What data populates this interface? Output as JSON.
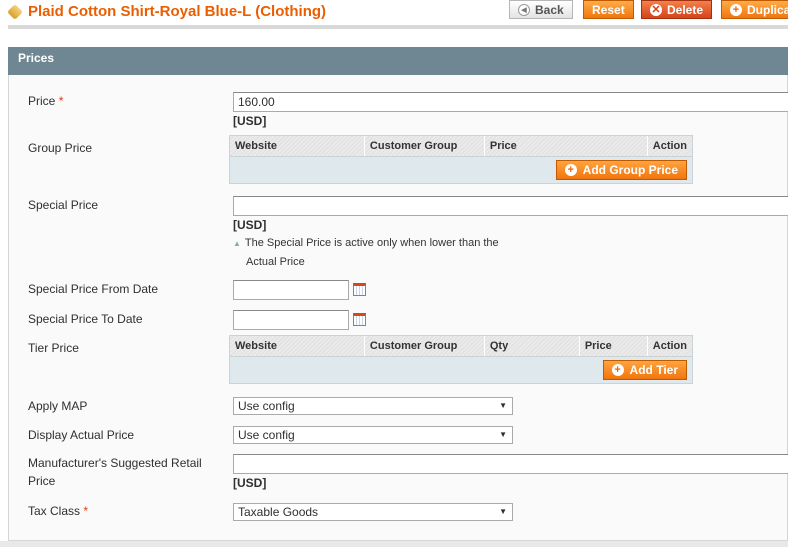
{
  "header": {
    "title": "Plaid Cotton Shirt-Royal Blue-L (Clothing)",
    "buttons": {
      "back": "Back",
      "reset": "Reset",
      "delete": "Delete",
      "duplicate": "Duplicate"
    }
  },
  "section": {
    "title": "Prices"
  },
  "fields": {
    "price": {
      "label": "Price",
      "required": "*",
      "value": "160.00",
      "currency": "[USD]"
    },
    "group_price": {
      "label": "Group Price",
      "columns": [
        "Website",
        "Customer Group",
        "Price",
        "Action"
      ],
      "add_button": "Add Group Price"
    },
    "special_price": {
      "label": "Special Price",
      "value": "",
      "currency": "[USD]",
      "note_line1": "The Special Price is active only when lower than the",
      "note_line2": "Actual Price"
    },
    "special_from": {
      "label": "Special Price From Date",
      "value": ""
    },
    "special_to": {
      "label": "Special Price To Date",
      "value": ""
    },
    "tier_price": {
      "label": "Tier Price",
      "columns": [
        "Website",
        "Customer Group",
        "Qty",
        "Price",
        "Action"
      ],
      "add_button": "Add Tier"
    },
    "apply_map": {
      "label": "Apply MAP",
      "value": "Use config"
    },
    "display_actual": {
      "label": "Display Actual Price",
      "value": "Use config"
    },
    "msrp": {
      "label_line1": "Manufacturer's Suggested Retail",
      "label_line2": "Price",
      "value": "",
      "currency": "[USD]"
    },
    "tax_class": {
      "label": "Tax Class",
      "required": "*",
      "value": "Taxable Goods"
    }
  }
}
